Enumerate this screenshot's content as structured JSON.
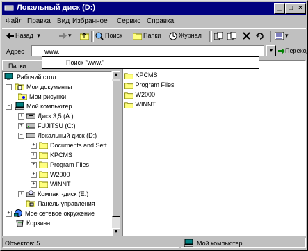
{
  "window": {
    "title": "Локальный диск (D:)"
  },
  "menu": [
    "Файл",
    "Правка",
    "Вид",
    "Избранное",
    "Сервис",
    "Справка"
  ],
  "toolbar": {
    "back": "Назад",
    "search": "Поиск",
    "folders": "Папки",
    "history": "Журнал"
  },
  "address": {
    "label": "Адрес",
    "value": "www.",
    "go": "Переход",
    "suggestion": "Поиск \"www.\""
  },
  "folders_pane": {
    "header": "Папки",
    "tree": [
      {
        "label": "Рабочий стол",
        "icon": "desktop-icon"
      },
      {
        "label": "Мои документы",
        "icon": "my-documents-icon"
      },
      {
        "label": "Мои рисунки",
        "icon": "my-pictures-icon"
      },
      {
        "label": "Мой компьютер",
        "icon": "my-computer-icon"
      },
      {
        "label": "Диск 3,5 (A:)",
        "icon": "floppy-drive-icon"
      },
      {
        "label": "FUJITSU (C:)",
        "icon": "hard-drive-icon"
      },
      {
        "label": "Локальный диск (D:)",
        "icon": "hard-drive-icon"
      },
      {
        "label": "Documents and Sett",
        "icon": "folder-icon"
      },
      {
        "label": "KPCMS",
        "icon": "folder-icon"
      },
      {
        "label": "Program Files",
        "icon": "folder-icon"
      },
      {
        "label": "W2000",
        "icon": "folder-icon"
      },
      {
        "label": "WINNT",
        "icon": "folder-icon"
      },
      {
        "label": "Компакт-диск (E:)",
        "icon": "cd-drive-icon"
      },
      {
        "label": "Панель управления",
        "icon": "control-panel-icon"
      },
      {
        "label": "Мое сетевое окружение",
        "icon": "network-icon"
      },
      {
        "label": "Корзина",
        "icon": "recycle-bin-icon"
      }
    ]
  },
  "files": [
    "KPCMS",
    "Program Files",
    "W2000",
    "WINNT"
  ],
  "status": {
    "objects": "Объектов: 5",
    "location": "Мой компьютер"
  }
}
